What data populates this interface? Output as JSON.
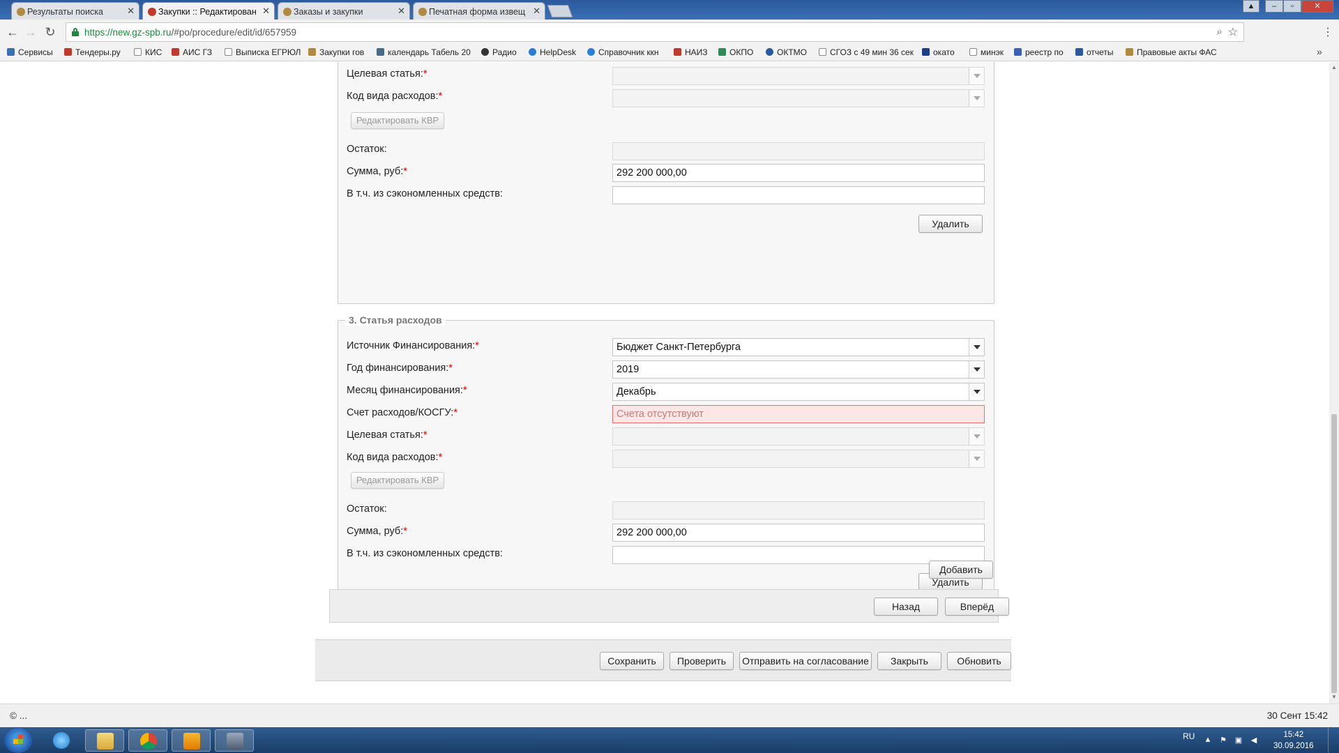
{
  "browser": {
    "tabs": [
      {
        "label": "Результаты поиска"
      },
      {
        "label": "Закупки :: Редактирован"
      },
      {
        "label": "Заказы и закупки"
      },
      {
        "label": "Печатная форма извещ"
      }
    ],
    "url_host": "https://new.gz-spb.ru",
    "url_path": "/#po/procedure/edit/id/657959",
    "bookmarks": [
      {
        "label": "Сервисы",
        "icon": "apps-grid-icon",
        "color": "#3b6fb5"
      },
      {
        "label": "Тендеры.ру",
        "icon": "tenders-icon",
        "color": "#c0392b"
      },
      {
        "label": "КИС",
        "icon": "page-icon",
        "color": "#888888"
      },
      {
        "label": "АИС ГЗ",
        "icon": "ais-icon",
        "color": "#c0392b"
      },
      {
        "label": "Выписка ЕГРЮЛ",
        "icon": "page-icon",
        "color": "#888888"
      },
      {
        "label": "Закупки гов",
        "icon": "emblem-icon",
        "color": "#b08a3e"
      },
      {
        "label": "календарь Табель 20",
        "icon": "calendar-icon",
        "color": "#4a6a8a"
      },
      {
        "label": "Радио",
        "icon": "play-icon",
        "color": "#333333"
      },
      {
        "label": "HelpDesk",
        "icon": "globe-icon",
        "color": "#2a7fd4"
      },
      {
        "label": "Справочник ккн",
        "icon": "globe-icon",
        "color": "#2a7fd4"
      },
      {
        "label": "НАИЗ",
        "icon": "naiz-icon",
        "color": "#c0392b"
      },
      {
        "label": "ОКПО",
        "icon": "okpo-icon",
        "color": "#2e8b57"
      },
      {
        "label": "ОКТМО",
        "icon": "oktmo-icon",
        "color": "#2a5a9c"
      },
      {
        "label": "СГОЗ с 49 мин 36 сек",
        "icon": "page-icon",
        "color": "#888888"
      },
      {
        "label": "окато",
        "icon": "okato-icon",
        "color": "#1a3e8a"
      },
      {
        "label": "минэк",
        "icon": "page-icon",
        "color": "#888888"
      },
      {
        "label": "реестр по",
        "icon": "emblem-icon",
        "color": "#3b5fb5"
      },
      {
        "label": "отчеты",
        "icon": "reports-icon",
        "color": "#2a5a9c"
      },
      {
        "label": "Правовые акты ФАС",
        "icon": "emblem-icon",
        "color": "#b08a3e"
      }
    ],
    "bookmarks_more": "»"
  },
  "form": {
    "section2": {
      "target_article_label": "Целевая статья:",
      "expense_type_label": "Код вида расходов:",
      "edit_kvr_button": "Редактировать КВР",
      "balance_label": "Остаток:",
      "balance_value": "",
      "amount_label": "Сумма, руб:",
      "amount_value": "292 200 000,00",
      "saved_funds_label": "В т.ч. из сэкономленных средств:",
      "saved_funds_value": "",
      "delete_button": "Удалить"
    },
    "section3": {
      "legend": "3. Статья расходов",
      "funding_source_label": "Источник Финансирования:",
      "funding_source_value": "Бюджет Санкт-Петербурга",
      "funding_year_label": "Год финансирования:",
      "funding_year_value": "2019",
      "funding_month_label": "Месяц финансирования:",
      "funding_month_value": "Декабрь",
      "expense_account_label": "Счет расходов/КОСГУ:",
      "expense_account_value": "Счета отсутствуют",
      "target_article_label": "Целевая статья:",
      "expense_type_label": "Код вида расходов:",
      "edit_kvr_button": "Редактировать КВР",
      "balance_label": "Остаток:",
      "balance_value": "",
      "amount_label": "Сумма, руб:",
      "amount_value": "292 200 000,00",
      "saved_funds_label": "В т.ч. из сэкономленных средств:",
      "saved_funds_value": "",
      "delete_button": "Удалить"
    },
    "required_mark": "*",
    "add_button": "Добавить",
    "back_button": "Назад",
    "forward_button": "Вперёд"
  },
  "footer_actions": {
    "save": "Сохранить",
    "check": "Проверить",
    "send_for_approval": "Отправить на согласование",
    "close": "Закрыть",
    "refresh": "Обновить"
  },
  "status_bar": {
    "left": "© ...",
    "right": "30 Сент 15:42"
  },
  "taskbar": {
    "language": "RU",
    "time": "15:42",
    "date": "30.09.2016"
  },
  "colors": {
    "required": "#dd0000",
    "error_field_bg": "#fde6e6",
    "error_field_border": "#e86a6a",
    "url_secure": "#1a8a3a"
  }
}
